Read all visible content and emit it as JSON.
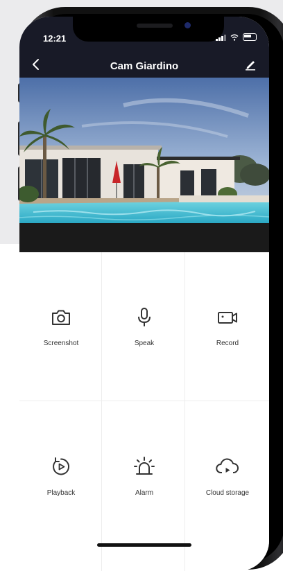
{
  "status_bar": {
    "time": "12:21",
    "icons": [
      "signal-icon",
      "wifi-icon",
      "battery-icon"
    ]
  },
  "header": {
    "title": "Cam Giardino",
    "back_icon": "chevron-left-icon",
    "edit_icon": "pencil-icon"
  },
  "actions": [
    {
      "label": "Screenshot",
      "icon": "camera-icon"
    },
    {
      "label": "Speak",
      "icon": "microphone-icon"
    },
    {
      "label": "Record",
      "icon": "video-camera-icon"
    },
    {
      "label": "Playback",
      "icon": "playback-icon"
    },
    {
      "label": "Alarm",
      "icon": "siren-icon"
    },
    {
      "label": "Cloud storage",
      "icon": "cloud-play-icon"
    }
  ],
  "colors": {
    "header_bg": "#181a27",
    "icon": "#333333",
    "page_bg": "#ebebed"
  }
}
